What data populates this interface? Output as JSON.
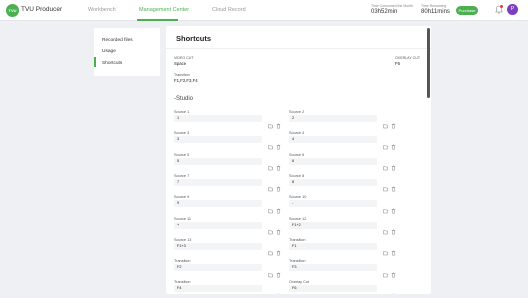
{
  "header": {
    "logo_text": "TVU",
    "brand": "TVU Producer",
    "nav": [
      "Workbench",
      "Management Center",
      "Cloud Record"
    ],
    "active_nav_index": 1,
    "stats": [
      {
        "label": "Time Consumed the Month",
        "value": "03h52min",
        "unit": ""
      },
      {
        "label": "Time Remaining",
        "value": "80h11mins",
        "unit": ""
      }
    ],
    "purchase_label": "Purchase",
    "avatar_letter": "P"
  },
  "sidebar": {
    "items": [
      "Recorded files",
      "Usage",
      "Shortcuts"
    ],
    "active_index": 2
  },
  "main": {
    "title": "Shortcuts",
    "video_cut_label": "VIDEO CUT",
    "video_cut_value": "Space",
    "overlay_cut_label": "OVERLAY CUT",
    "overlay_cut_value": "F6",
    "transition_label": "Transition",
    "transition_value": "F1,F2,F3,F4",
    "section_title": "-Studio",
    "fields": [
      {
        "label": "Source 1",
        "value": "1"
      },
      {
        "label": "Source 2",
        "value": "2"
      },
      {
        "label": "Source 3",
        "value": "3"
      },
      {
        "label": "Source 4",
        "value": "4"
      },
      {
        "label": "Source 5",
        "value": "5"
      },
      {
        "label": "Source 6",
        "value": "6"
      },
      {
        "label": "Source 7",
        "value": "7"
      },
      {
        "label": "Source 8",
        "value": "8"
      },
      {
        "label": "Source 9",
        "value": "9"
      },
      {
        "label": "Source 10",
        "value": "-"
      },
      {
        "label": "Source 11",
        "value": "+"
      },
      {
        "label": "Source 12",
        "value": "F1+2"
      },
      {
        "label": "Source 13",
        "value": "F1+3"
      },
      {
        "label": "Transition",
        "value": "F1"
      },
      {
        "label": "Transition",
        "value": "F2"
      },
      {
        "label": "Transition",
        "value": "F3"
      },
      {
        "label": "Transition",
        "value": "F4"
      },
      {
        "label": "Overlay Cut",
        "value": "F6"
      }
    ]
  },
  "colors": {
    "accent": "#4caf50",
    "avatar": "#7b3fbf",
    "background": "#eef0f3"
  }
}
